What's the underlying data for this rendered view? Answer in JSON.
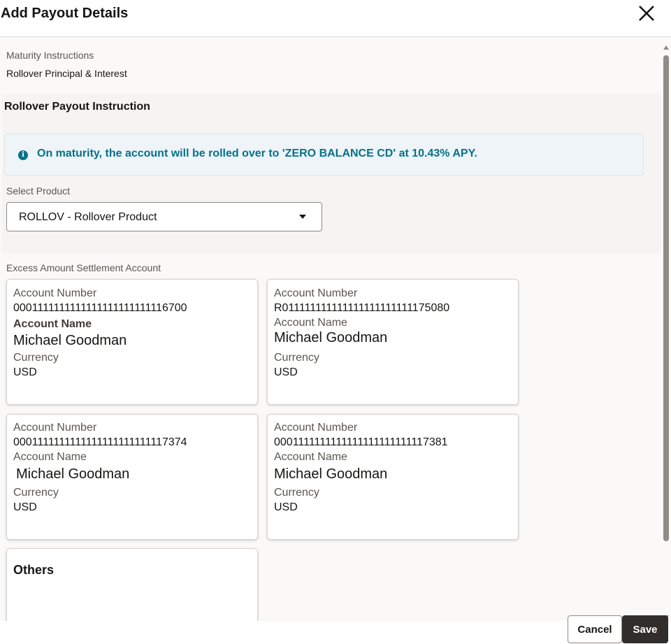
{
  "dialog": {
    "title": "Add Payout Details",
    "close_icon": "close-icon"
  },
  "maturity": {
    "label": "Maturity Instructions",
    "value": "Rollover Principal & Interest"
  },
  "rollover": {
    "title": "Rollover Payout Instruction",
    "info_icon": "info-icon",
    "info_text": "On maturity, the account will be rolled over to 'ZERO BALANCE CD' at 10.43% APY.",
    "select_label": "Select Product",
    "select_value": "ROLLOV - Rollover Product"
  },
  "settlement": {
    "label": "Excess Amount Settlement Account",
    "field_labels": {
      "account_number": "Account Number",
      "account_name": "Account Name",
      "currency": "Currency"
    },
    "accounts": [
      {
        "number": "0001111111111111111111111116700",
        "name": "Michael Goodman",
        "currency": "USD"
      },
      {
        "number": "R011111111111111111111111175080",
        "name": "Michael Goodman",
        "currency": "USD"
      },
      {
        "number": "0001111111111111111111111117374",
        "name": "Michael Goodman",
        "currency": "USD"
      },
      {
        "number": "0001111111111111111111111117381",
        "name": "Michael Goodman",
        "currency": "USD"
      }
    ],
    "others_label": "Others"
  },
  "footer": {
    "cancel_label": "Cancel",
    "save_label": "Save"
  },
  "colors": {
    "accent": "#04728a",
    "primary_button": "#312d2a",
    "info_background": "#eef4f8"
  }
}
